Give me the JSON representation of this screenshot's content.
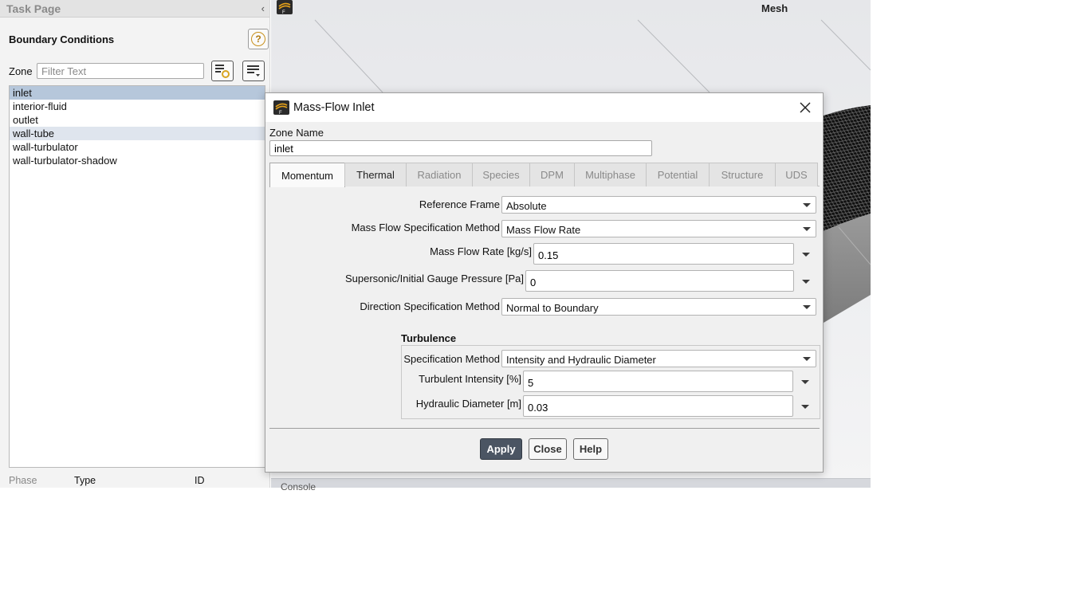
{
  "task_page": {
    "title": "Task Page",
    "panel_title": "Boundary Conditions",
    "zone_label": "Zone",
    "filter_placeholder": "Filter Text",
    "zones": [
      {
        "label": "inlet",
        "state": "selected"
      },
      {
        "label": "interior-fluid",
        "state": ""
      },
      {
        "label": "outlet",
        "state": ""
      },
      {
        "label": "wall-tube",
        "state": "highlight"
      },
      {
        "label": "wall-turbulator",
        "state": ""
      },
      {
        "label": "wall-turbulator-shadow",
        "state": ""
      }
    ],
    "footer": {
      "phase": "Phase",
      "type": "Type",
      "id": "ID"
    }
  },
  "graphics": {
    "title": "Mesh",
    "console_label": "Console"
  },
  "dialog": {
    "title": "Mass-Flow Inlet",
    "zone_name_label": "Zone Name",
    "zone_name_value": "inlet",
    "tabs": [
      {
        "label": "Momentum",
        "state": "active"
      },
      {
        "label": "Thermal",
        "state": "semi"
      },
      {
        "label": "Radiation",
        "state": ""
      },
      {
        "label": "Species",
        "state": ""
      },
      {
        "label": "DPM",
        "state": ""
      },
      {
        "label": "Multiphase",
        "state": ""
      },
      {
        "label": "Potential",
        "state": ""
      },
      {
        "label": "Structure",
        "state": ""
      },
      {
        "label": "UDS",
        "state": ""
      }
    ],
    "momentum": {
      "reference_frame_label": "Reference Frame",
      "reference_frame_value": "Absolute",
      "mf_spec_label": "Mass Flow Specification Method",
      "mf_spec_value": "Mass Flow Rate",
      "mfr_label": "Mass Flow Rate [kg/s]",
      "mfr_value": "0.15",
      "pressure_label": "Supersonic/Initial Gauge Pressure [Pa]",
      "pressure_value": "0",
      "dir_label": "Direction Specification Method",
      "dir_value": "Normal to Boundary",
      "turbulence": {
        "title": "Turbulence",
        "spec_label": "Specification Method",
        "spec_value": "Intensity and Hydraulic Diameter",
        "intensity_label": "Turbulent Intensity [%]",
        "intensity_value": "5",
        "diameter_label": "Hydraulic Diameter [m]",
        "diameter_value": "0.03"
      }
    },
    "buttons": {
      "apply": "Apply",
      "close": "Close",
      "help": "Help"
    }
  },
  "colors": {
    "selected_row": "#b6c7db",
    "primary_button": "#4b5563",
    "mesh_dark": "#1c1c1c",
    "mesh_gray": "#8e8e8e"
  }
}
